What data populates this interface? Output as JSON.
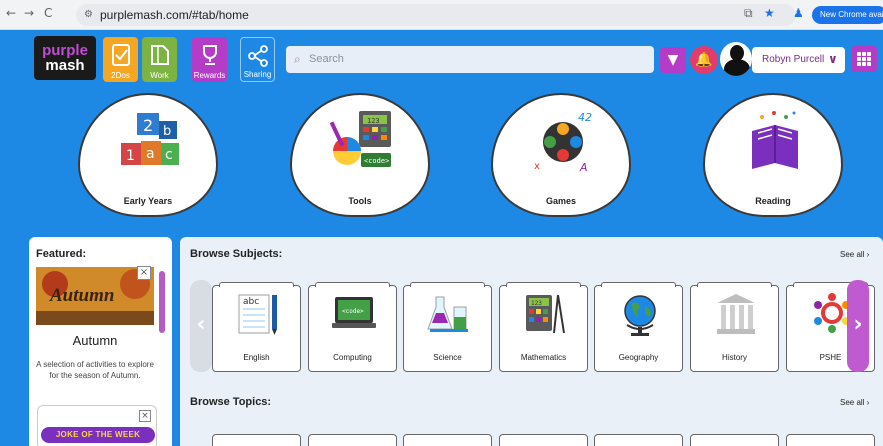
{
  "browser": {
    "back": "←",
    "forward": "→",
    "reload": "C",
    "url": "purplemash.com/#tab/home",
    "update_notice": "New Chrome availab"
  },
  "header": {
    "logo_line1": "purple",
    "logo_line2": "mash",
    "tabs": [
      {
        "label": "2Dos",
        "color": "#f5a623",
        "icon": "checklist-icon"
      },
      {
        "label": "Work",
        "color": "#7cb342",
        "icon": "folder-icon"
      },
      {
        "label": "Rewards",
        "color": "#b43cc7",
        "icon": "trophy-icon"
      },
      {
        "label": "Sharing",
        "color": "#1e88e5",
        "icon": "share-icon"
      }
    ],
    "search_placeholder": "Search",
    "user_name": "Robyn Purcell"
  },
  "quick_tiles": [
    {
      "label": "Early Years",
      "icon": "letter-blocks-icon"
    },
    {
      "label": "Tools",
      "icon": "paint-tools-icon"
    },
    {
      "label": "Games",
      "icon": "gamepad-icon"
    },
    {
      "label": "Reading",
      "icon": "book-icon"
    }
  ],
  "featured": {
    "title": "Featured:",
    "image_word": "Autumn",
    "item_title": "Autumn",
    "item_desc": "A selection of activities to explore for the season of Autumn.",
    "next_item": "JOKE OF THE WEEK"
  },
  "browse": {
    "subjects_title": "Browse Subjects:",
    "topics_title": "Browse Topics:",
    "see_all": "See all ›",
    "subjects": [
      {
        "label": "English",
        "icon": "notebook-pen-icon"
      },
      {
        "label": "Computing",
        "icon": "laptop-code-icon",
        "screen_text": "<code>"
      },
      {
        "label": "Science",
        "icon": "flasks-icon"
      },
      {
        "label": "Mathematics",
        "icon": "calculator-compass-icon",
        "screen_text": "123"
      },
      {
        "label": "Geography",
        "icon": "globe-icon"
      },
      {
        "label": "History",
        "icon": "columns-icon"
      },
      {
        "label": "PSHE",
        "icon": "people-circle-icon"
      }
    ]
  },
  "colors": {
    "background": "#1e88e5",
    "accent_purple": "#b43cc7",
    "accent_pink": "#e23b6d"
  }
}
